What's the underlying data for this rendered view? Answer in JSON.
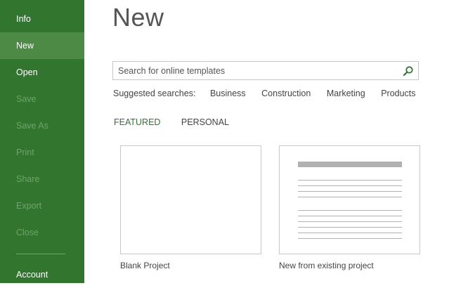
{
  "sidebar": {
    "items": [
      {
        "label": "Info",
        "state": "normal"
      },
      {
        "label": "New",
        "state": "active"
      },
      {
        "label": "Open",
        "state": "normal"
      },
      {
        "label": "Save",
        "state": "disabled"
      },
      {
        "label": "Save As",
        "state": "disabled"
      },
      {
        "label": "Print",
        "state": "disabled"
      },
      {
        "label": "Share",
        "state": "disabled"
      },
      {
        "label": "Export",
        "state": "disabled"
      },
      {
        "label": "Close",
        "state": "disabled"
      }
    ],
    "account_label": "Account"
  },
  "main": {
    "title": "New",
    "search": {
      "placeholder": "Search for online templates",
      "value": "",
      "icon": "search-icon"
    },
    "suggested": {
      "label": "Suggested searches:",
      "links": [
        "Business",
        "Construction",
        "Marketing",
        "Products"
      ]
    },
    "tabs": [
      {
        "label": "FEATURED",
        "selected": true
      },
      {
        "label": "PERSONAL",
        "selected": false
      }
    ],
    "templates": [
      {
        "label": "Blank Project"
      },
      {
        "label": "New from existing project"
      }
    ]
  },
  "colors": {
    "sidebar": "#31752f",
    "sidebar_active": "#4c8a45",
    "accent": "#31752f"
  }
}
